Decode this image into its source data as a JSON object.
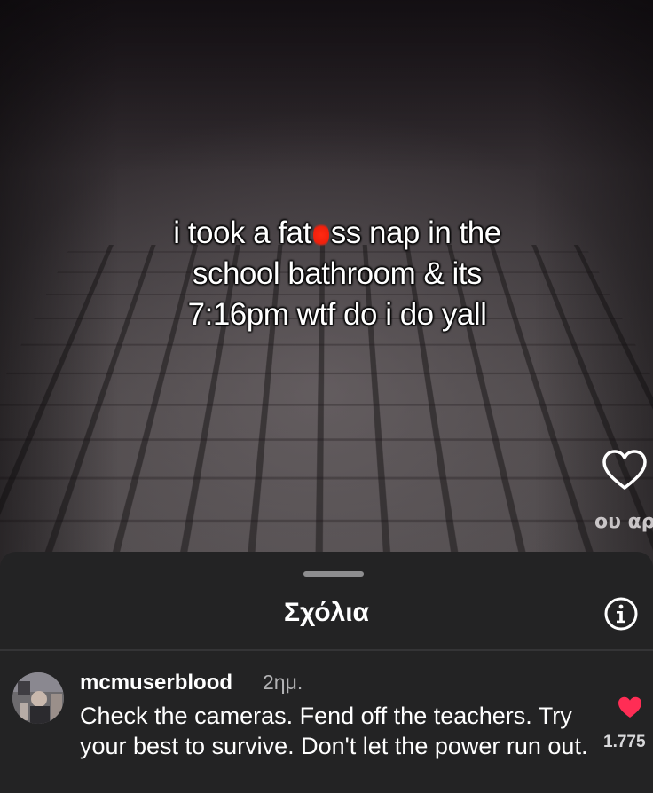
{
  "video": {
    "caption_lines": [
      [
        "i took a fat",
        "ss nap in the"
      ],
      [
        "school bathroom & its"
      ],
      [
        "7:16pm wtf do i do yall"
      ]
    ],
    "music_snippet": "ου αρ",
    "heart_icon": "heart-outline-icon"
  },
  "comments_sheet": {
    "title": "Σχόλια",
    "info_icon": "info-icon",
    "comments": [
      {
        "username": "mcmuserblood",
        "time": "2ημ.",
        "text": "Check the cameras. Fend off the teachers. Try your best to survive. Don't let the power run out.",
        "likes": "1.775",
        "liked": true,
        "like_color": "#ff2d55"
      }
    ]
  }
}
